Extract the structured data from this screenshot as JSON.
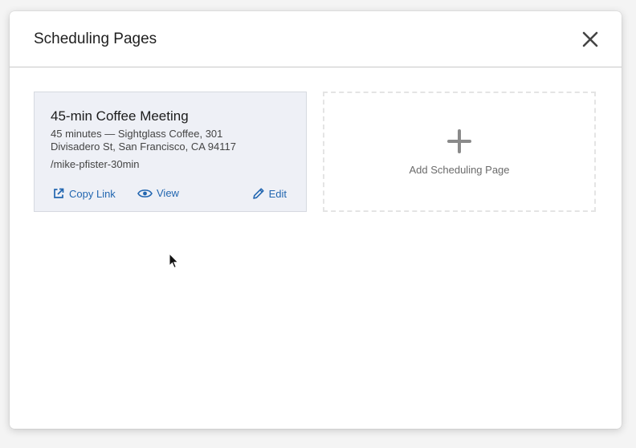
{
  "modal": {
    "title": "Scheduling Pages",
    "close_icon": "close-icon"
  },
  "cards": [
    {
      "title": "45-min Coffee Meeting",
      "description": "45 minutes — Sightglass Coffee, 301 Divisadero St, San Francisco, CA 94117",
      "slug": "/mike-pfister-30min",
      "actions": {
        "copy_link": "Copy Link",
        "view": "View",
        "edit": "Edit"
      }
    }
  ],
  "add_card": {
    "label": "Add Scheduling Page",
    "icon": "plus-icon"
  },
  "colors": {
    "link": "#2266b0",
    "card_bg": "#eef0f6",
    "plus": "#8a8a8a"
  }
}
